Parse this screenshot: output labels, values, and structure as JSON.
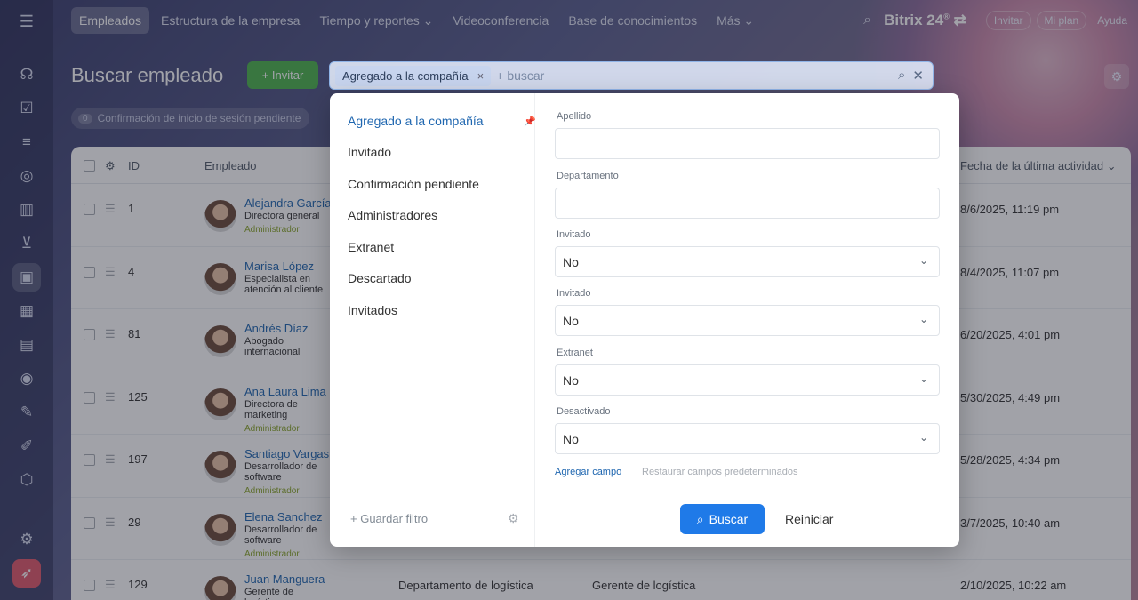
{
  "nav": {
    "items": [
      "Empleados",
      "Estructura de la empresa",
      "Tiempo y reportes ⌄",
      "Videoconferencia",
      "Base de conocimientos",
      "Más ⌄"
    ],
    "brand": "Bitrix 24",
    "brand_suffix": "®",
    "invite": "Invitar",
    "plan": "Mi plan",
    "help": "Ayuda"
  },
  "rail": {
    "icons": [
      "menu-icon",
      "headset-icon",
      "task-icon",
      "filter-icon",
      "robot-icon",
      "chart-icon",
      "cart-icon",
      "employees-icon",
      "calendar-icon",
      "drive-icon",
      "target-icon",
      "doc-icon",
      "pen-icon",
      "box-icon"
    ]
  },
  "header": {
    "title": "Buscar empleado",
    "invite_button": "+ Invitar",
    "pending": "Confirmación de inicio de sesión pendiente",
    "pending_count": "0"
  },
  "filter": {
    "tag": "Agregado a la compañía",
    "placeholder": "+ buscar"
  },
  "table": {
    "columns": {
      "id": "ID",
      "employee": "Empleado",
      "last_activity": "Fecha de la última actividad ⌄"
    },
    "rows": [
      {
        "id": "1",
        "name": "Alejandra García",
        "position": "Directora general",
        "role": "Administrador",
        "dept": "",
        "pos2": "",
        "activity": "8/6/2025, 11:19 pm"
      },
      {
        "id": "4",
        "name": "Marisa López",
        "position": "Especialista en atención al cliente",
        "role": "",
        "dept": "",
        "pos2": "",
        "activity": "8/4/2025, 11:07 pm"
      },
      {
        "id": "81",
        "name": "Andrés Díaz",
        "position": "Abogado internacional",
        "role": "",
        "dept": "",
        "pos2": "",
        "activity": "6/20/2025, 4:01 pm"
      },
      {
        "id": "125",
        "name": "Ana Laura Lima",
        "position": "Directora de marketing",
        "role": "Administrador",
        "dept": "",
        "pos2": "",
        "activity": "5/30/2025, 4:49 pm"
      },
      {
        "id": "197",
        "name": "Santiago Vargas",
        "position": "Desarrollador de software",
        "role": "Administrador",
        "dept": "",
        "pos2": "",
        "activity": "5/28/2025, 4:34 pm"
      },
      {
        "id": "29",
        "name": "Elena Sanchez",
        "position": "Desarrollador de software",
        "role": "Administrador",
        "dept": "",
        "pos2": "",
        "activity": "3/7/2025, 10:40 am"
      },
      {
        "id": "129",
        "name": "Juan Manguera",
        "position": "Gerente de logística",
        "role": "",
        "dept": "Departamento de logística",
        "pos2": "Gerente de logística",
        "activity": "2/10/2025, 10:22 am"
      }
    ]
  },
  "popup": {
    "presets": [
      "Agregado a la compañía",
      "Invitado",
      "Confirmación pendiente",
      "Administradores",
      "Extranet",
      "Descartado",
      "Invitados"
    ],
    "save_filter": "+ Guardar filtro",
    "fields": [
      {
        "label": "Apellido",
        "value": "",
        "select": false
      },
      {
        "label": "Departamento",
        "value": "",
        "select": false
      },
      {
        "label": "Invitado",
        "value": "No",
        "select": true
      },
      {
        "label": "Invitado",
        "value": "No",
        "select": true
      },
      {
        "label": "Extranet",
        "value": "No",
        "select": true
      },
      {
        "label": "Desactivado",
        "value": "No",
        "select": true
      }
    ],
    "add_field": "Agregar campo",
    "restore_fields": "Restaurar campos predeterminados",
    "search_button": "Buscar",
    "reset_button": "Reiniciar"
  }
}
